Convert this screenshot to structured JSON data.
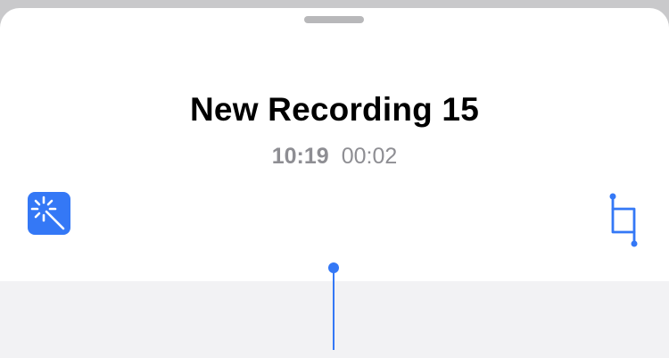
{
  "recording": {
    "title": "New Recording 15",
    "time_of_day": "10:19",
    "duration": "00:02"
  },
  "toolbar": {
    "enhance_icon": "magic-wand-icon",
    "trim_icon": "crop-trim-icon"
  },
  "colors": {
    "accent": "#3478f6",
    "secondary_text": "#8e8e93",
    "waveform_background": "#f2f2f4"
  }
}
